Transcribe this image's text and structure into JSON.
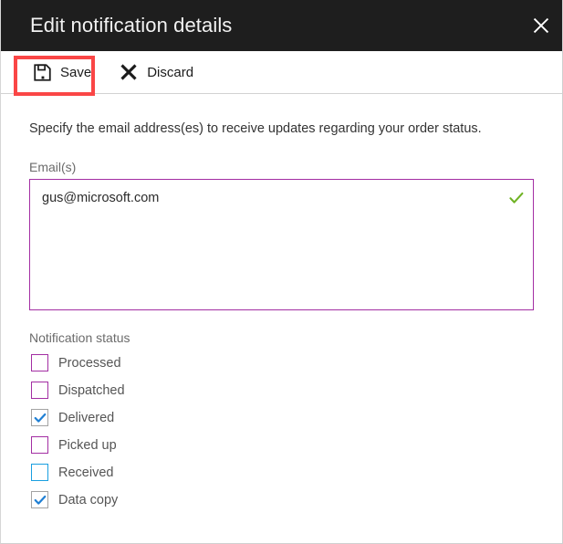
{
  "header": {
    "title": "Edit notification details",
    "close_icon": "close-icon",
    "background_color": "#1e1e1e",
    "title_color": "#f2f2f2"
  },
  "commandbar": {
    "actions": [
      {
        "label": "Save",
        "icon": "save-floppy-disk-icon",
        "highlighted": true
      },
      {
        "label": "Discard",
        "icon": "x-cross-icon",
        "highlighted": false
      }
    ],
    "highlight_color": "#fa4646"
  },
  "body": {
    "intro_text": "Specify the email address(es) to receive updates regarding your order status.",
    "email_field": {
      "label": "Email(s)",
      "value": "gus@microsoft.com",
      "placeholder": "",
      "border_color": "#a32ea3",
      "validation_icon": "green-checkmark-icon",
      "validation_color": "#70b325"
    },
    "notification_status": {
      "label": "Notification status",
      "items": [
        {
          "label": "Processed",
          "checked": false,
          "state": "default",
          "border_color": "#a32ea3"
        },
        {
          "label": "Dispatched",
          "checked": false,
          "state": "default",
          "border_color": "#a32ea3"
        },
        {
          "label": "Delivered",
          "checked": true,
          "state": "checked",
          "border_color": "#a3a3a3"
        },
        {
          "label": "Picked up",
          "checked": false,
          "state": "default",
          "border_color": "#a32ea3"
        },
        {
          "label": "Received",
          "checked": false,
          "state": "hover",
          "border_color": "#1a9fe0"
        },
        {
          "label": "Data copy",
          "checked": true,
          "state": "checked",
          "border_color": "#a3a3a3"
        }
      ],
      "check_color": "#1f7fd4"
    }
  }
}
